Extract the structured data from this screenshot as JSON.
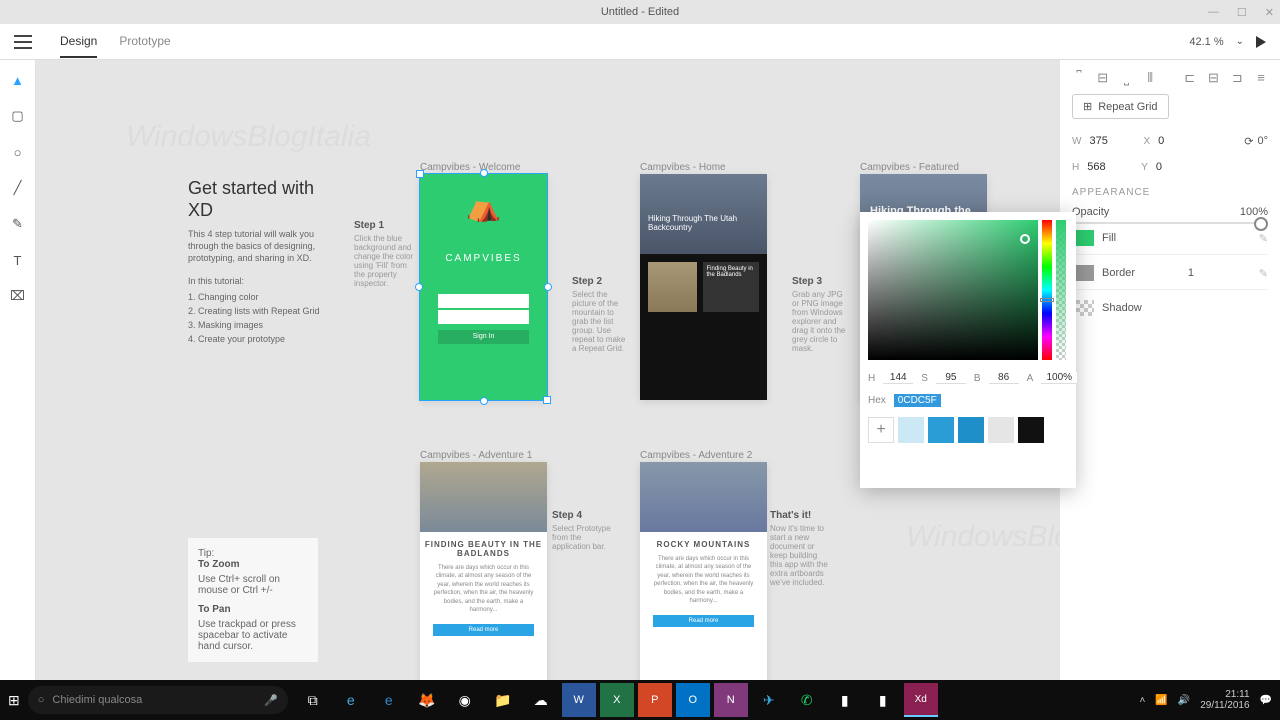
{
  "title": "Untitled - Edited",
  "tabs": {
    "design": "Design",
    "prototype": "Prototype"
  },
  "zoom": "42.1 %",
  "tutorial": {
    "title": "Get started with XD",
    "desc": "This 4 step tutorial will walk you through the basics of designing, prototyping, and sharing in XD.",
    "intro": "In this tutorial:",
    "items": [
      "1. Changing color",
      "2. Creating lists with Repeat Grid",
      "3. Masking images",
      "4. Create your prototype"
    ]
  },
  "tips": {
    "title": "Tip:",
    "zoom_h": "To Zoom",
    "zoom_t": "Use Ctrl+ scroll on mouse or Ctrl +/-",
    "pan_h": "To Pan",
    "pan_t": "Use trackpad or press spacebar to activate hand cursor."
  },
  "artboards": {
    "welcome": "Campvibes - Welcome",
    "home": "Campvibes - Home",
    "featured": "Campvibes - Featured",
    "adv1": "Campvibes - Adventure 1",
    "adv2": "Campvibes - Adventure 2",
    "logo": "CAMPVIBES",
    "signin": "Sign In",
    "hiking": "Hiking Through the Utah Backcountry",
    "hiking2": "Hiking Through The Utah Backcountry",
    "finding": "FINDING BEAUTY IN THE BADLANDS",
    "rocky": "ROCKY MOUNTAINS",
    "readmore": "Read more"
  },
  "steps": {
    "s1": {
      "h": "Step 1",
      "t": "Click the blue background and change the color using 'Fill' from the property inspector."
    },
    "s2": {
      "h": "Step 2",
      "t": "Select the picture of the mountain to grab the list group. Use repeat to make a Repeat Grid."
    },
    "s3": {
      "h": "Step 3",
      "t": "Grab any JPG or PNG image from Windows explorer and drag it onto the grey circle to mask."
    },
    "s4": {
      "h": "Step 4",
      "t": "Select Prototype from the application bar."
    },
    "s5": {
      "h": "That's it!",
      "t": "Now it's time to start a new document or keep building this app with the extra artboards we've included."
    }
  },
  "panel": {
    "repeat": "Repeat Grid",
    "w": "375",
    "x": "0",
    "h": "568",
    "y": "0",
    "deg": "0°",
    "appearance": "APPEARANCE",
    "opacity": "Opacity",
    "opv": "100%",
    "fill": "Fill",
    "border": "Border",
    "bw": "1",
    "shadow": "Shadow"
  },
  "picker": {
    "h": "144",
    "s": "95",
    "b": "86",
    "a": "100%",
    "hex": "0CDC5F",
    "hl": "H",
    "sl": "S",
    "bl": "B",
    "al": "A",
    "hexl": "Hex"
  },
  "taskbar": {
    "search": "Chiedimi qualcosa",
    "time": "21:11",
    "date": "29/11/2016"
  },
  "watermark": "WindowsBlogItalia"
}
